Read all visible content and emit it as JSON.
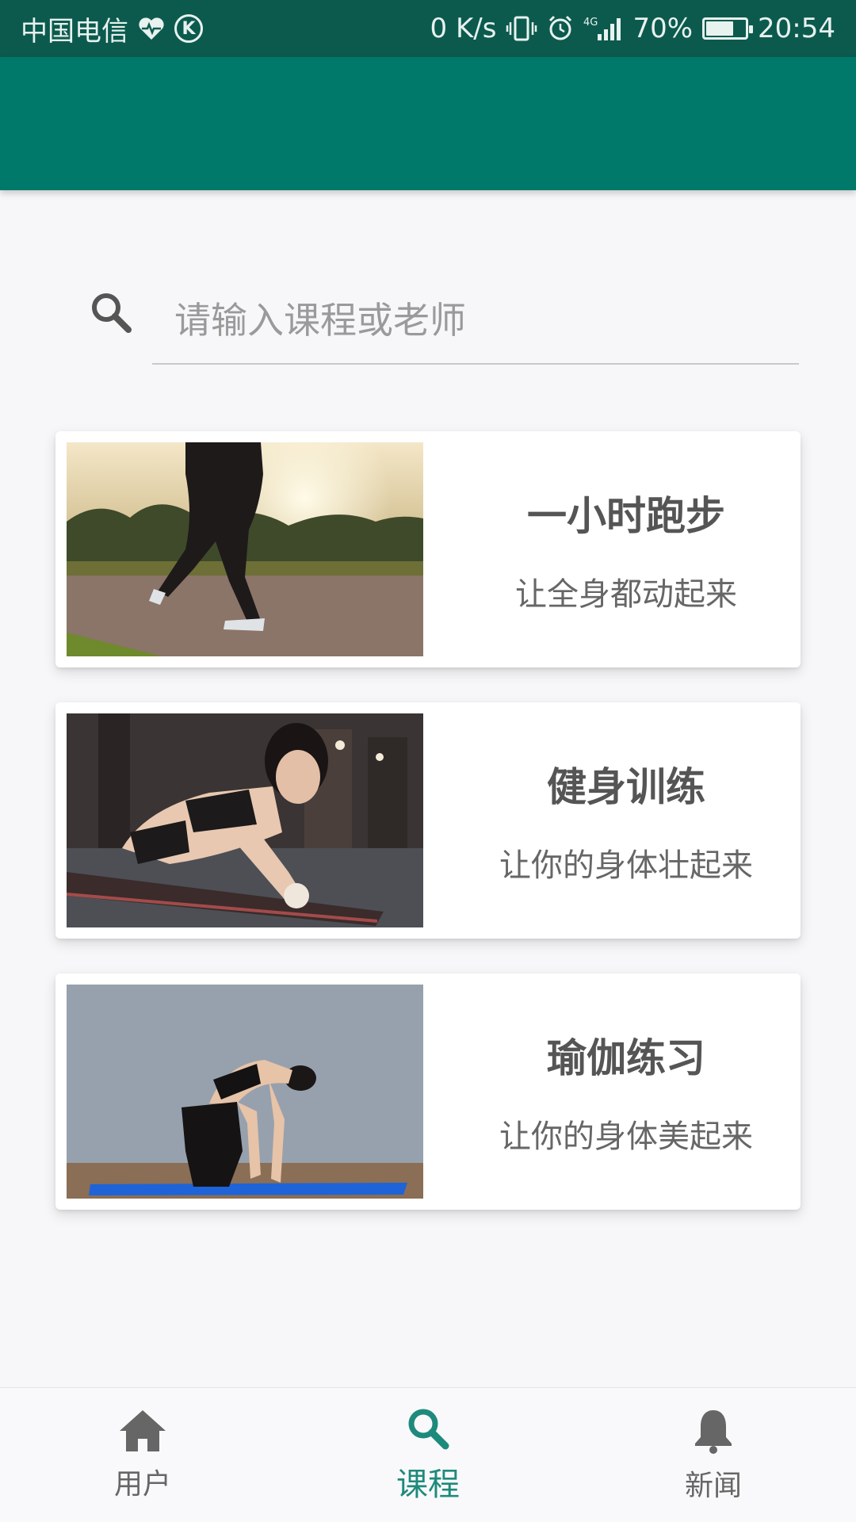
{
  "status_bar": {
    "carrier": "中国电信",
    "net_speed": "0 K/s",
    "network": "4G",
    "battery": "70%",
    "battery_level": 0.7,
    "time": "20:54"
  },
  "search": {
    "placeholder": "请输入课程或老师"
  },
  "courses": [
    {
      "title": "一小时跑步",
      "subtitle": "让全身都动起来"
    },
    {
      "title": "健身训练",
      "subtitle": "让你的身体壮起来"
    },
    {
      "title": "瑜伽练习",
      "subtitle": "让你的身体美起来"
    }
  ],
  "bottom_nav": [
    {
      "label": "用户",
      "icon": "home-icon"
    },
    {
      "label": "课程",
      "icon": "search-icon",
      "active": true
    },
    {
      "label": "新闻",
      "icon": "bell-icon"
    }
  ],
  "colors": {
    "status_bar": "#0c5a4e",
    "app_bar": "#00796b",
    "accent": "#1e8a7b"
  }
}
